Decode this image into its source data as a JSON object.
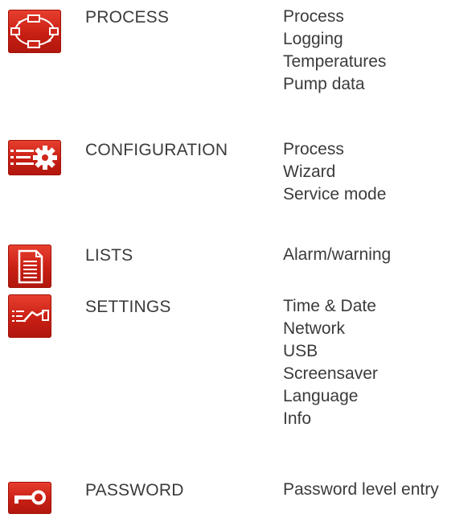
{
  "menu": [
    {
      "icon": "process-cycle-icon",
      "title": "PROCESS",
      "items": [
        "Process",
        "Logging",
        "Temperatures",
        "Pump data"
      ]
    },
    {
      "icon": "configuration-gear-icon",
      "title": "CONFIGURATION",
      "items": [
        "Process",
        "Wizard",
        "Service mode"
      ]
    },
    {
      "icon": "list-document-icon",
      "title": "LISTS",
      "items": [
        "Alarm/warning"
      ]
    },
    {
      "icon": "settings-hand-icon",
      "title": "SETTINGS",
      "items": [
        "Time & Date",
        "Network",
        "USB",
        "Screensaver",
        "Language",
        "Info"
      ]
    },
    {
      "icon": "password-key-icon",
      "title": "PASSWORD",
      "items": [
        "Password level entry"
      ]
    }
  ],
  "colors": {
    "icon_red": "#d1271a",
    "text": "#3b3b3b"
  }
}
